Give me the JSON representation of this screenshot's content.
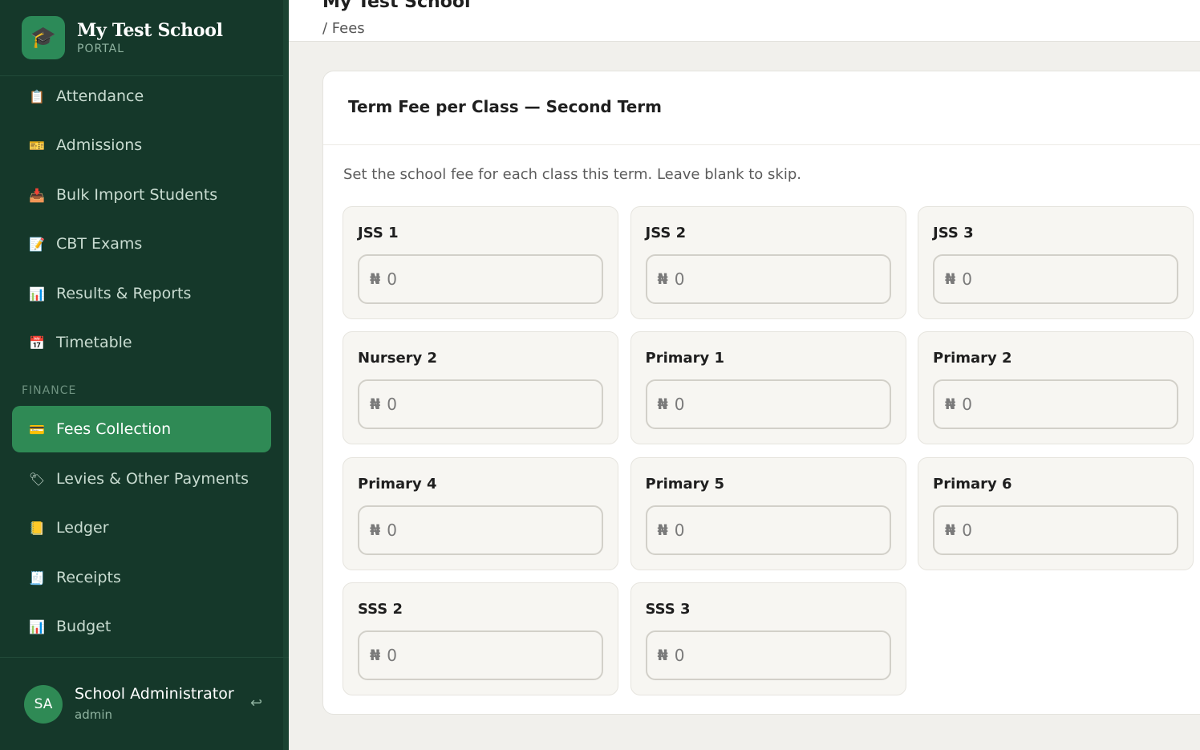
{
  "brand": {
    "name": "My Test School",
    "subtitle": "PORTAL",
    "logo_icon": "graduation-cap-icon"
  },
  "sidebar": {
    "items": [
      {
        "label": "Attendance",
        "icon": "clipboard-icon",
        "color": "#8a8a6a",
        "glyph": "📋"
      },
      {
        "label": "Admissions",
        "icon": "ticket-icon",
        "color": "#c9a227",
        "glyph": "🎫"
      },
      {
        "label": "Bulk Import Students",
        "icon": "inbox-tray-icon",
        "color": "#5a7fb5",
        "glyph": "📥"
      },
      {
        "label": "CBT Exams",
        "icon": "memo-icon",
        "color": "#c9a227",
        "glyph": "📝"
      },
      {
        "label": "Results & Reports",
        "icon": "bar-chart-icon",
        "color": "#5a8fb5",
        "glyph": "📊"
      },
      {
        "label": "Timetable",
        "icon": "calendar-icon",
        "color": "#5a7fb5",
        "glyph": "📅"
      }
    ],
    "section_label": "FINANCE",
    "finance_items": [
      {
        "label": "Fees Collection",
        "icon": "credit-card-icon",
        "active": true,
        "glyph": "💳"
      },
      {
        "label": "Levies & Other Payments",
        "icon": "tag-icon",
        "glyph": "🏷"
      },
      {
        "label": "Ledger",
        "icon": "ledger-icon",
        "glyph": "📒"
      },
      {
        "label": "Receipts",
        "icon": "receipt-icon",
        "glyph": "🧾"
      },
      {
        "label": "Budget",
        "icon": "bar-chart-icon",
        "glyph": "📊"
      }
    ],
    "user": {
      "initials": "SA",
      "name": "School Administrator",
      "role": "admin",
      "logout_glyph": "↩"
    }
  },
  "header": {
    "title": "My Test School",
    "breadcrumb": "/ Fees"
  },
  "card": {
    "title": "Term Fee per Class — Second Term",
    "description": "Set the school fee for each class this term. Leave blank to skip.",
    "currency_symbol": "₦",
    "placeholder": "0",
    "classes": [
      {
        "label": "JSS 1",
        "value": ""
      },
      {
        "label": "JSS 2",
        "value": ""
      },
      {
        "label": "JSS 3",
        "value": ""
      },
      {
        "label": "Nursery 2",
        "value": ""
      },
      {
        "label": "Primary 1",
        "value": ""
      },
      {
        "label": "Primary 2",
        "value": ""
      },
      {
        "label": "Primary 4",
        "value": ""
      },
      {
        "label": "Primary 5",
        "value": ""
      },
      {
        "label": "Primary 6",
        "value": ""
      },
      {
        "label": "SSS 2",
        "value": ""
      },
      {
        "label": "SSS 3",
        "value": ""
      }
    ]
  },
  "colors": {
    "sidebar_bg": "#15382a",
    "active_bg": "#2f8a55",
    "accent": "#2f8a55"
  }
}
